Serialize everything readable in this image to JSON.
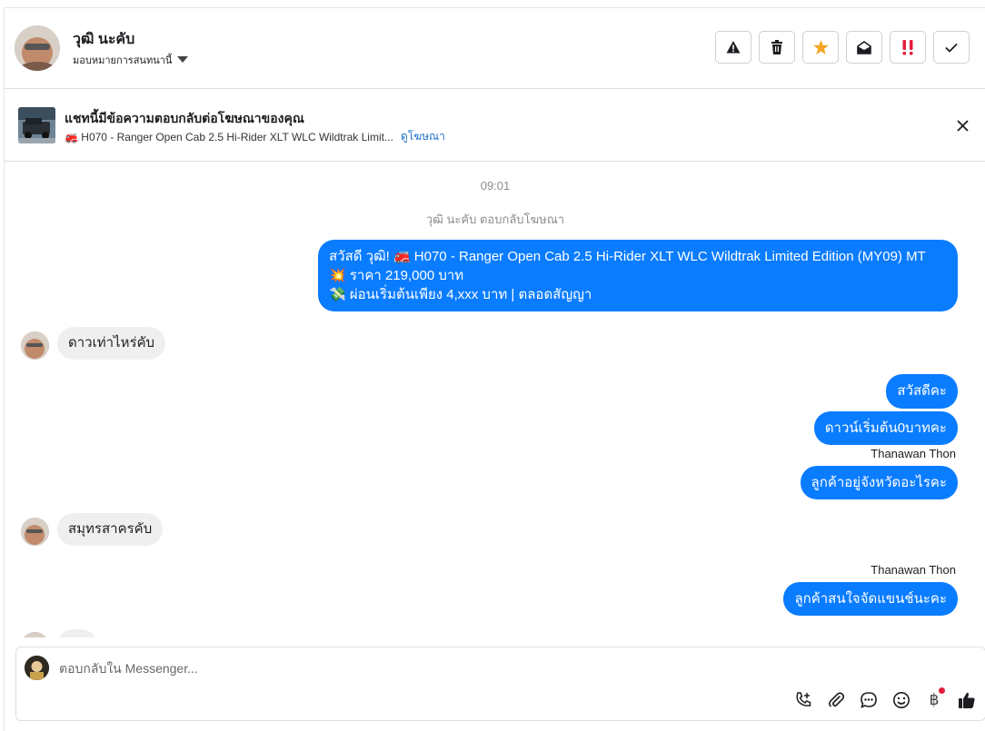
{
  "header": {
    "contact_name": "วุฒิ นะคับ",
    "assign_label": "มอบหมายการสนทนานี้",
    "actions": [
      {
        "name": "report-button",
        "icon": "warning-icon"
      },
      {
        "name": "delete-button",
        "icon": "trash-icon"
      },
      {
        "name": "star-button",
        "icon": "star-icon",
        "color": "#f5a623"
      },
      {
        "name": "mark-unread-button",
        "icon": "envelope-open-icon"
      },
      {
        "name": "priority-button",
        "icon": "double-exclamation-icon",
        "color": "#e41e3f"
      },
      {
        "name": "done-button",
        "icon": "check-icon"
      }
    ]
  },
  "banner": {
    "title": "แชทนี้มีข้อความตอบกลับต่อโฆษณาของคุณ",
    "ad_text": "🚒 H070 - Ranger Open Cab 2.5 Hi-Rider XLT WLC Wildtrak Limit...",
    "view_ad_label": "ดูโฆษณา"
  },
  "thread": {
    "timestamp": "09:01",
    "ad_reply_note": "วุฒิ นะคับ ตอบกลับโฆษณา",
    "messages": [
      {
        "direction": "out",
        "lines": [
          "สวัสดี วุฒิ! 🚒 H070 - Ranger Open Cab 2.5 Hi-Rider XLT WLC Wildtrak Limited Edition (MY09) MT",
          "💥 ราคา 219,000 บาท",
          "💸 ผ่อนเริ่มต้นเพียง 4,xxx บาท | ตลอดสัญญา"
        ]
      },
      {
        "direction": "in",
        "text": "ดาวเท่าไหร่คับ"
      },
      {
        "direction": "out",
        "text": "สวัสดีคะ"
      },
      {
        "direction": "out",
        "text": "ดาวน์เริ่มต้น0บาทคะ"
      },
      {
        "direction": "out",
        "sender": "Thanawan Thon",
        "text": "ลูกค้าอยู่จังหวัดอะไรคะ"
      },
      {
        "direction": "in",
        "text": "สมุทรสาครคับ"
      },
      {
        "direction": "out",
        "sender": "Thanawan Thon",
        "text": "ลูกค้าสนใจจัดแขนช์นะคะ"
      }
    ]
  },
  "composer": {
    "placeholder": "ตอบกลับใน Messenger...",
    "tools": [
      "call-add-icon",
      "attachment-icon",
      "saved-reply-icon",
      "emoji-icon",
      "baht-payment-icon",
      "like-icon"
    ],
    "baht_symbol": "฿"
  },
  "colors": {
    "outgoing_bubble": "#0a7cff",
    "incoming_bubble": "#efefef",
    "link": "#1c6fcc"
  }
}
